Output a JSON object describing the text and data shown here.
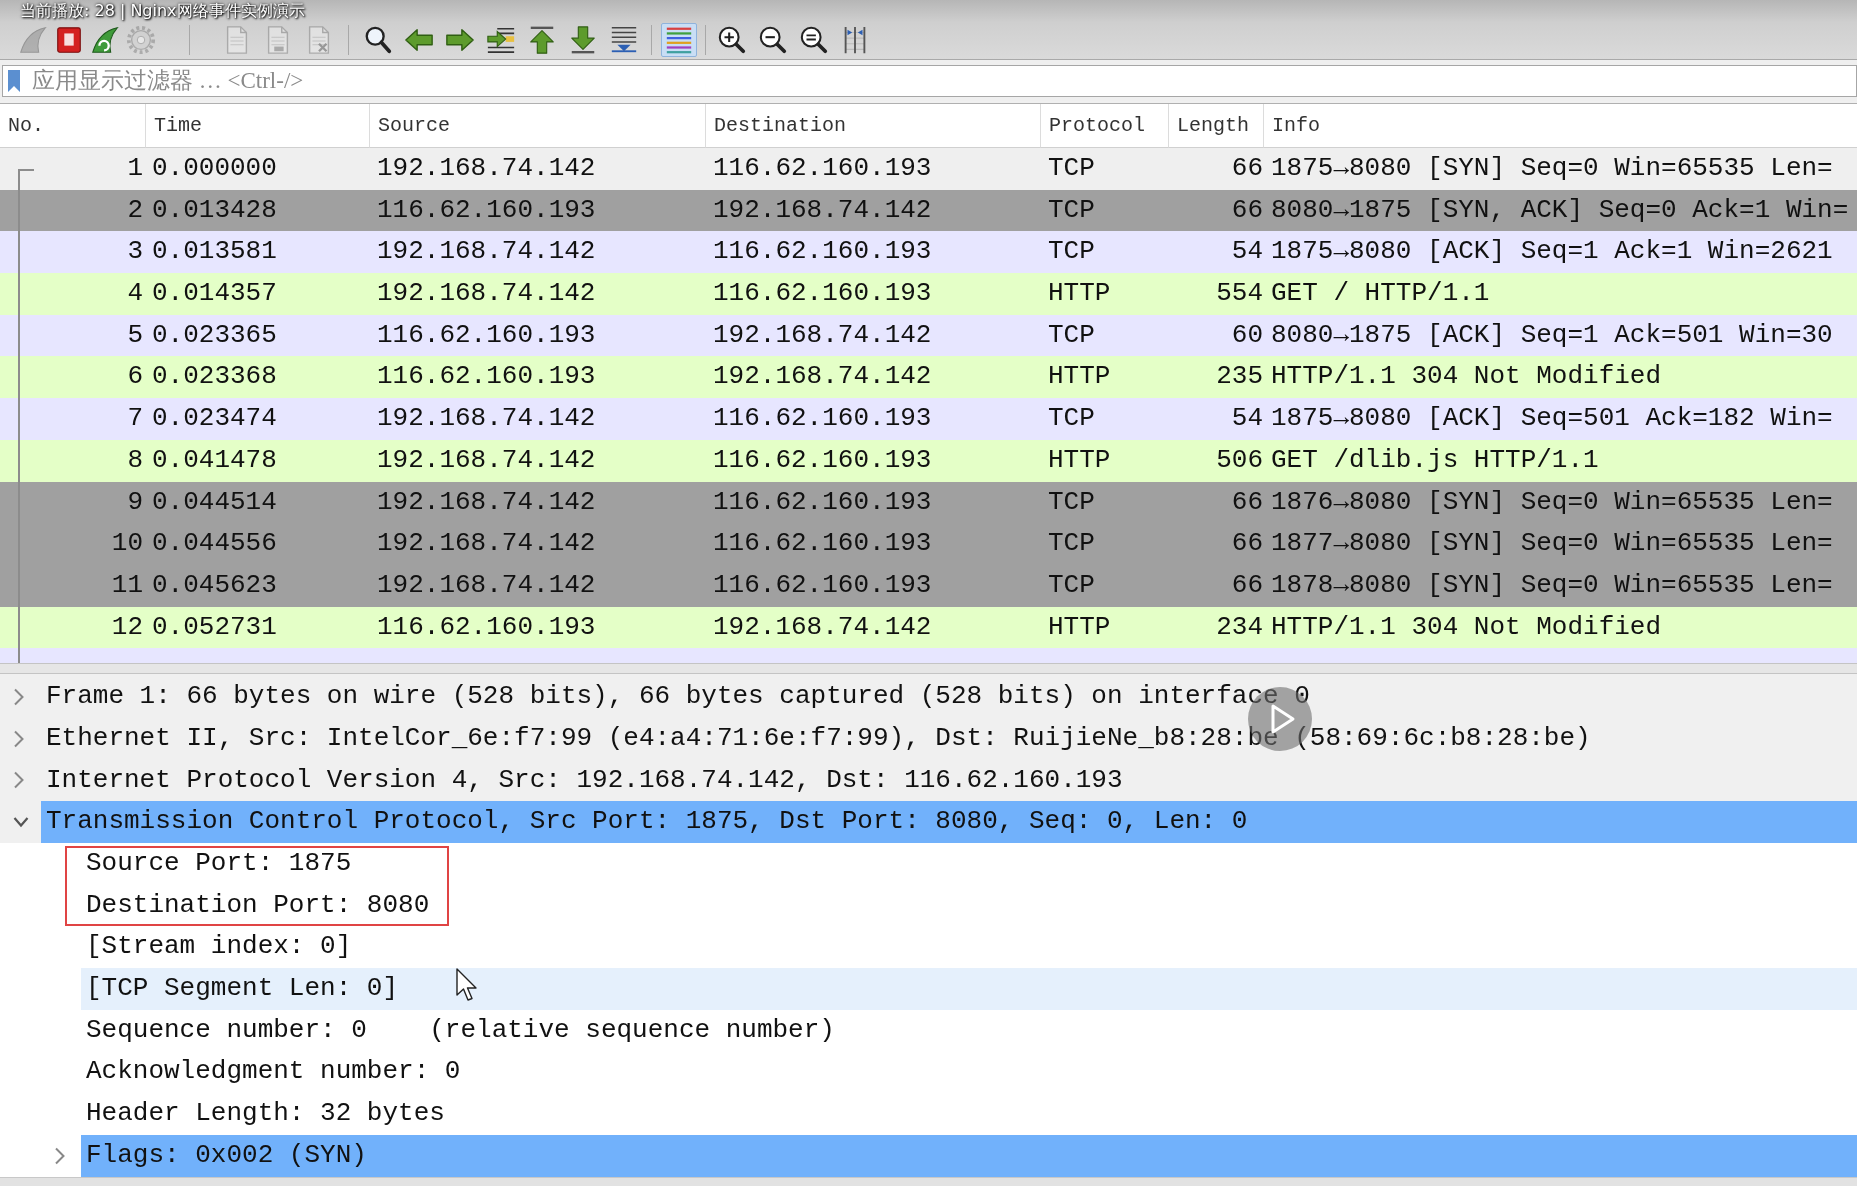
{
  "player_overlay": {
    "now_playing": "当前播放: 28 | Nginx网络事件实例演示"
  },
  "toolbar_groups": [
    {
      "buttons": [
        {
          "kind": "start",
          "disabled": true,
          "pressed": false
        },
        {
          "kind": "stop",
          "disabled": false,
          "pressed": false
        },
        {
          "kind": "restart",
          "disabled": false,
          "pressed": false
        },
        {
          "kind": "options",
          "disabled": true,
          "pressed": false
        }
      ]
    },
    {
      "buttons": [
        {
          "kind": "open",
          "disabled": true,
          "pressed": false
        },
        {
          "kind": "save",
          "disabled": true,
          "pressed": false
        },
        {
          "kind": "close",
          "disabled": true,
          "pressed": false
        }
      ]
    },
    {
      "buttons": [
        {
          "kind": "find",
          "disabled": false,
          "pressed": false
        },
        {
          "kind": "back",
          "disabled": false,
          "pressed": false
        },
        {
          "kind": "forward",
          "disabled": false,
          "pressed": false
        },
        {
          "kind": "goto",
          "disabled": false,
          "pressed": false
        },
        {
          "kind": "first",
          "disabled": false,
          "pressed": false
        },
        {
          "kind": "last",
          "disabled": false,
          "pressed": false
        },
        {
          "kind": "autoscroll",
          "disabled": false,
          "pressed": false
        }
      ]
    },
    {
      "buttons": [
        {
          "kind": "colorize",
          "disabled": false,
          "pressed": true
        }
      ]
    },
    {
      "buttons": [
        {
          "kind": "zoomin",
          "disabled": false,
          "pressed": false
        },
        {
          "kind": "zoomout",
          "disabled": false,
          "pressed": false
        },
        {
          "kind": "normal",
          "disabled": false,
          "pressed": false
        },
        {
          "kind": "resize",
          "disabled": false,
          "pressed": false
        }
      ]
    }
  ],
  "filter": {
    "placeholder": "应用显示过滤器 … <Ctrl-/>"
  },
  "packet_list": {
    "columns": [
      "No.",
      "Time",
      "Source",
      "Destination",
      "Protocol",
      "Length",
      "Info"
    ],
    "rows": [
      {
        "no": "1",
        "time": "0.000000",
        "source": "192.168.74.142",
        "destination": "116.62.160.193",
        "protocol": "TCP",
        "length": "66",
        "info": "1875→8080 [SYN] Seq=0 Win=65535 Len=",
        "selected": true
      },
      {
        "no": "2",
        "time": "0.013428",
        "source": "116.62.160.193",
        "destination": "192.168.74.142",
        "protocol": "TCP",
        "length": "66",
        "info": "8080→1875 [SYN, ACK] Seq=0 Ack=1 Win=",
        "color": "#a0a0a0",
        "selected": false
      },
      {
        "no": "3",
        "time": "0.013581",
        "source": "192.168.74.142",
        "destination": "116.62.160.193",
        "protocol": "TCP",
        "length": "54",
        "info": "1875→8080 [ACK] Seq=1 Ack=1 Win=2621",
        "color": "#e7e6ff",
        "selected": false
      },
      {
        "no": "4",
        "time": "0.014357",
        "source": "192.168.74.142",
        "destination": "116.62.160.193",
        "protocol": "HTTP",
        "length": "554",
        "info": "GET / HTTP/1.1",
        "color": "#e4ffc7",
        "selected": false
      },
      {
        "no": "5",
        "time": "0.023365",
        "source": "116.62.160.193",
        "destination": "192.168.74.142",
        "protocol": "TCP",
        "length": "60",
        "info": "8080→1875 [ACK] Seq=1 Ack=501 Win=30",
        "color": "#e7e6ff",
        "selected": false
      },
      {
        "no": "6",
        "time": "0.023368",
        "source": "116.62.160.193",
        "destination": "192.168.74.142",
        "protocol": "HTTP",
        "length": "235",
        "info": "HTTP/1.1 304 Not Modified",
        "color": "#e4ffc7",
        "selected": false
      },
      {
        "no": "7",
        "time": "0.023474",
        "source": "192.168.74.142",
        "destination": "116.62.160.193",
        "protocol": "TCP",
        "length": "54",
        "info": "1875→8080 [ACK] Seq=501 Ack=182 Win=",
        "color": "#e7e6ff",
        "selected": false
      },
      {
        "no": "8",
        "time": "0.041478",
        "source": "192.168.74.142",
        "destination": "116.62.160.193",
        "protocol": "HTTP",
        "length": "506",
        "info": "GET /dlib.js HTTP/1.1",
        "color": "#e4ffc7",
        "selected": false
      },
      {
        "no": "9",
        "time": "0.044514",
        "source": "192.168.74.142",
        "destination": "116.62.160.193",
        "protocol": "TCP",
        "length": "66",
        "info": "1876→8080 [SYN] Seq=0 Win=65535 Len=",
        "color": "#a0a0a0",
        "selected": false
      },
      {
        "no": "10",
        "time": "0.044556",
        "source": "192.168.74.142",
        "destination": "116.62.160.193",
        "protocol": "TCP",
        "length": "66",
        "info": "1877→8080 [SYN] Seq=0 Win=65535 Len=",
        "color": "#a0a0a0",
        "selected": false
      },
      {
        "no": "11",
        "time": "0.045623",
        "source": "192.168.74.142",
        "destination": "116.62.160.193",
        "protocol": "TCP",
        "length": "66",
        "info": "1878→8080 [SYN] Seq=0 Win=65535 Len=",
        "color": "#a0a0a0",
        "selected": false
      },
      {
        "no": "12",
        "time": "0.052731",
        "source": "116.62.160.193",
        "destination": "192.168.74.142",
        "protocol": "HTTP",
        "length": "234",
        "info": "HTTP/1.1 304 Not Modified",
        "color": "#e4ffc7",
        "selected": false
      }
    ]
  },
  "details": [
    {
      "kind": "subtree",
      "text": "Frame 1: 66 bytes on wire (528 bits), 66 bytes captured (528 bits) on interface 0",
      "expanded": false,
      "selected": false
    },
    {
      "kind": "subtree",
      "text": "Ethernet II, Src: IntelCor_6e:f7:99 (e4:a4:71:6e:f7:99), Dst: RuijieNe_b8:28:be (58:69:6c:b8:28:be)",
      "expanded": false,
      "selected": false
    },
    {
      "kind": "subtree",
      "text": "Internet Protocol Version 4, Src: 192.168.74.142, Dst: 116.62.160.193",
      "expanded": false,
      "selected": false
    },
    {
      "kind": "subtree",
      "text": "Transmission Control Protocol, Src Port: 1875, Dst Port: 8080, Seq: 0, Len: 0",
      "expanded": true,
      "selected": true,
      "children": [
        {
          "kind": "field",
          "text": "Source Port: 1875",
          "selected": false,
          "hovered": false,
          "annotated": true
        },
        {
          "kind": "field",
          "text": "Destination Port: 8080",
          "selected": false,
          "hovered": false,
          "annotated": true
        },
        {
          "kind": "field",
          "text": "[Stream index: 0]",
          "selected": false,
          "hovered": false,
          "annotated": false
        },
        {
          "kind": "field",
          "text": "[TCP Segment Len: 0]",
          "selected": false,
          "hovered": true,
          "annotated": false
        },
        {
          "kind": "field",
          "text": "Sequence number: 0    (relative sequence number)",
          "selected": false,
          "hovered": false,
          "annotated": false
        },
        {
          "kind": "field",
          "text": "Acknowledgment number: 0",
          "selected": false,
          "hovered": false,
          "annotated": false
        },
        {
          "kind": "field",
          "text": "Header Length: 32 bytes",
          "selected": false,
          "hovered": false,
          "annotated": false
        },
        {
          "kind": "subtree",
          "text": "Flags: 0x002 (SYN)",
          "expanded": false,
          "selected": true,
          "hovered": false,
          "annotated": false
        }
      ]
    }
  ]
}
